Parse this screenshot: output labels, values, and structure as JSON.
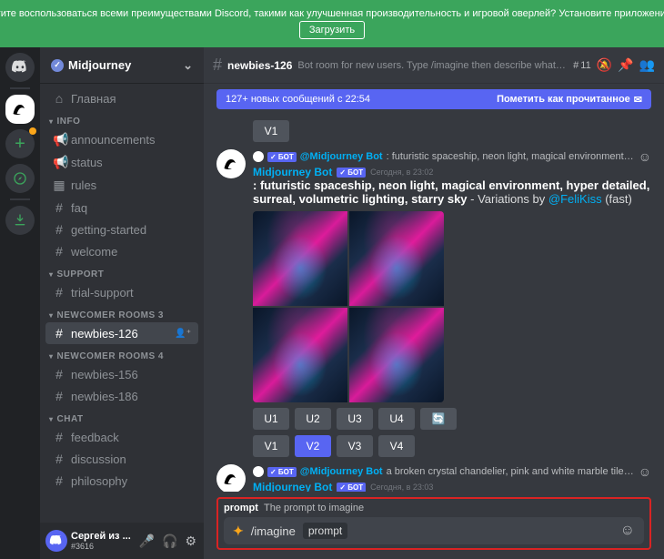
{
  "banner": {
    "text": "Хотите воспользоваться всеми преимуществами Discord, такими как улучшенная производительность и игровой оверлей? Установите приложение д",
    "button": "Загрузить"
  },
  "server": {
    "name": "Midjourney"
  },
  "sidebar": {
    "cat_info": "INFO",
    "cat_support": "SUPPORT",
    "cat_nr3": "NEWCOMER ROOMS 3",
    "cat_nr4": "NEWCOMER ROOMS 4",
    "cat_chat": "CHAT",
    "ch_home": "Главная",
    "ch_ann": "announcements",
    "ch_status": "status",
    "ch_rules": "rules",
    "ch_faq": "faq",
    "ch_gs": "getting-started",
    "ch_welcome": "welcome",
    "ch_trial": "trial-support",
    "ch_n126": "newbies-126",
    "ch_n156": "newbies-156",
    "ch_n186": "newbies-186",
    "ch_feedback": "feedback",
    "ch_discussion": "discussion",
    "ch_philosophy": "philosophy"
  },
  "user": {
    "name": "Сергей из ...",
    "tag": "#3616"
  },
  "header": {
    "channel": "newbies-126",
    "topic": "Bot room for new users. Type /imagine then describe what y...",
    "threads": "11"
  },
  "newmsg": {
    "text": "127+ новых сообщений с 22:54",
    "mark": "Пометить как прочитанное"
  },
  "btn_v1_top": "V1",
  "msg1": {
    "reply_author": "Midjourney Bot",
    "reply_text": ": futuristic spaceship, neon light, magical environment, hyper det...",
    "author": "Midjourney Bot",
    "bot": "✓ БОТ",
    "time": "Сегодня, в 23:02",
    "prompt": ": futuristic spaceship, neon light, magical environment, hyper detailed, surreal, volumetric lighting, starry sky",
    "variations": " - Variations by ",
    "user": "@FeliKiss",
    "fast": " (fast)",
    "u1": "U1",
    "u2": "U2",
    "u3": "U3",
    "u4": "U4",
    "v1": "V1",
    "v2": "V2",
    "v3": "V3",
    "v4": "V4"
  },
  "msg2": {
    "reply_author": "Midjourney Bot",
    "reply_text": "a broken crystal chandelier, pink and white marble tiles, pastel, p...",
    "author": "Midjourney Bot",
    "bot": "✓ БОТ",
    "time": "Сегодня, в 23:03",
    "prompt": "a broken crystal chandelier, pink and white marble tiles, pastel, petals, oranges,"
  },
  "input": {
    "hint_label": "prompt",
    "hint_text": "The prompt to imagine",
    "command": "/imagine",
    "arg": "prompt"
  }
}
